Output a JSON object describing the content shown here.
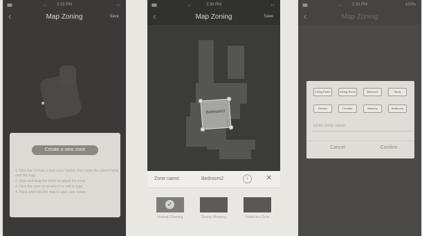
{
  "status": {
    "time_1": "3:33 PM",
    "time_2": "3:38 PM",
    "time_3": "3:34 PM",
    "battery_3": "100%"
  },
  "screen1": {
    "title": "Map Zoning",
    "save_label": "Save",
    "create_button": "Create a new zone",
    "instructions": [
      "1. Click the \"Create a new zone\" button, then draw the zoned frame over the map.",
      "2. Click and drag the frame to adjust the zone.",
      "3. Click the zone to rename it or edit its type.",
      "4. Press and hold the map to save your zones."
    ]
  },
  "screen2": {
    "title": "Map Zoning",
    "save_label": "Save",
    "zone_label": "Bedroom2",
    "name_label": "Zone name:",
    "name_value": "Bedroom2",
    "zone_types": [
      {
        "label": "Normal Cleaning",
        "color": "#7d7c78",
        "selected": true
      },
      {
        "label": "Deeply Mopping",
        "color": "#5d5b58",
        "selected": false
      },
      {
        "label": "Restricted Zone",
        "color": "#5a5856",
        "selected": false
      }
    ]
  },
  "screen3": {
    "title": "Map Zoning",
    "room_names": [
      "Living Room",
      "Dining Room",
      "Bedroom",
      "Study",
      "Kitchen",
      "Corridor",
      "Balcony",
      "Bathroom"
    ],
    "name_placeholder": "Enter zone name",
    "cancel_label": "Cancel",
    "confirm_label": "Confirm"
  }
}
